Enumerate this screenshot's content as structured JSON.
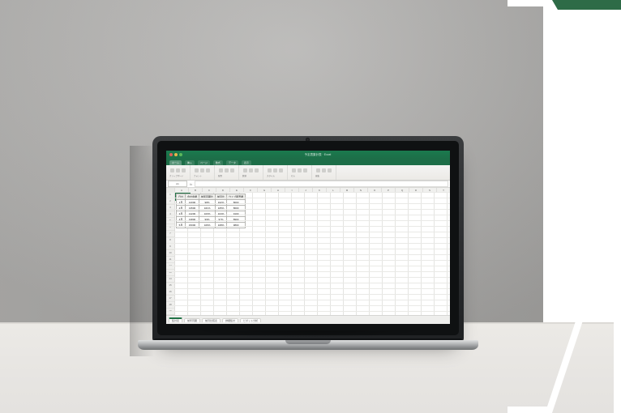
{
  "app": {
    "title": "予定表集計表 · Excel"
  },
  "tabs": [
    "ホーム",
    "挿入",
    "ページ",
    "数式",
    "データ",
    "表示"
  ],
  "ribbon_groups": [
    "クリップボード",
    "フォント",
    "配置",
    "数値",
    "スタイル",
    "セル",
    "編集"
  ],
  "cellref": "A1",
  "columns": [
    "",
    "A",
    "B",
    "C",
    "D",
    "E",
    "F",
    "G",
    "H",
    "I",
    "J",
    "K",
    "L",
    "M",
    "N",
    "O",
    "P",
    "Q",
    "R",
    "S",
    "T",
    "U",
    "V"
  ],
  "table": {
    "headers": [
      "日付",
      "合計金額",
      "前年同期比",
      "前月比",
      "ウェブ販売額"
    ],
    "rows": [
      [
        "1月",
        "12000",
        "98%",
        "102%",
        "8000"
      ],
      [
        "2月",
        "13500",
        "101%",
        "105%",
        "8600"
      ],
      [
        "3月",
        "14200",
        "103%",
        "104%",
        "9100"
      ],
      [
        "4月",
        "13800",
        "99%",
        "97%",
        "8900"
      ],
      [
        "5月",
        "15000",
        "106%",
        "108%",
        "9800"
      ]
    ]
  },
  "sheets": [
    "集計表",
    "前年同期",
    "前月比較表",
    "詳細集計",
    "ピボット分析"
  ],
  "active_sheet": 0,
  "row_count": 24
}
